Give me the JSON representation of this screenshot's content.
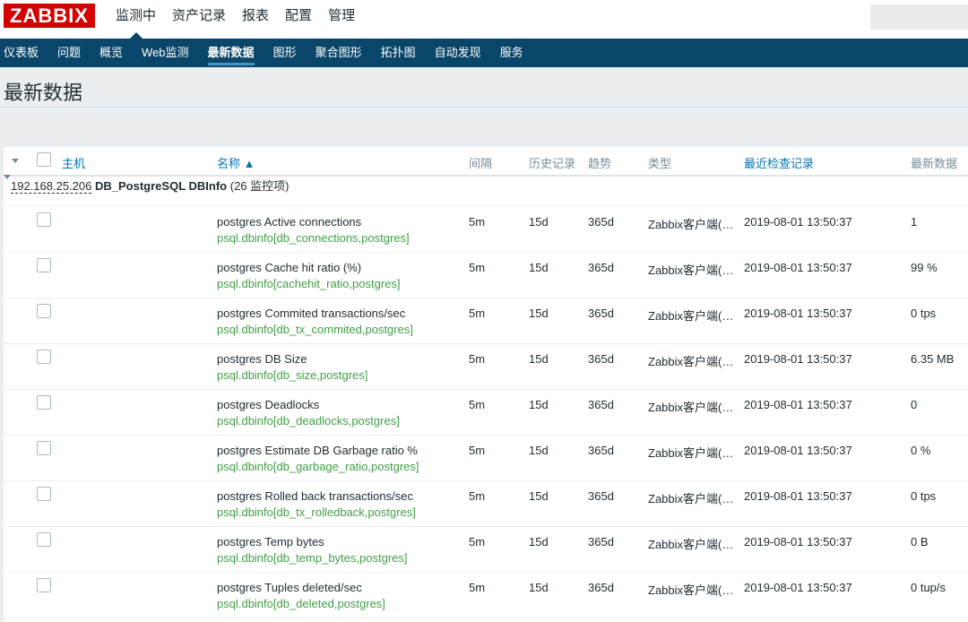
{
  "logo": "ZABBIX",
  "main_menu": [
    "监测中",
    "资产记录",
    "报表",
    "配置",
    "管理"
  ],
  "sub_menu": [
    "仪表板",
    "问题",
    "概览",
    "Web监测",
    "最新数据",
    "图形",
    "聚合图形",
    "拓扑图",
    "自动发现",
    "服务"
  ],
  "page_title": "最新数据",
  "table": {
    "headers": {
      "host": "主机",
      "name": "名称 ▲",
      "interval": "间隔",
      "history": "历史记录",
      "trends": "趋势",
      "type": "类型",
      "last_check": "最近检查记录",
      "last_value": "最新数据"
    },
    "group": {
      "host": "192.168.25.206",
      "app": "DB_PostgreSQL DBInfo",
      "count": "(26 监控项)"
    },
    "rows": [
      {
        "name": "postgres Active connections",
        "key": "psql.dbinfo[db_connections,postgres]",
        "interval": "5m",
        "history": "15d",
        "trends": "365d",
        "type": "Zabbix客户端(…",
        "last_check": "2019-08-01 13:50:37",
        "last_value": "1"
      },
      {
        "name": "postgres Cache hit ratio (%)",
        "key": "psql.dbinfo[cachehit_ratio,postgres]",
        "interval": "5m",
        "history": "15d",
        "trends": "365d",
        "type": "Zabbix客户端(…",
        "last_check": "2019-08-01 13:50:37",
        "last_value": "99 %"
      },
      {
        "name": "postgres Commited transactions/sec",
        "key": "psql.dbinfo[db_tx_commited,postgres]",
        "interval": "5m",
        "history": "15d",
        "trends": "365d",
        "type": "Zabbix客户端(…",
        "last_check": "2019-08-01 13:50:37",
        "last_value": "0 tps"
      },
      {
        "name": "postgres DB Size",
        "key": "psql.dbinfo[db_size,postgres]",
        "interval": "5m",
        "history": "15d",
        "trends": "365d",
        "type": "Zabbix客户端(…",
        "last_check": "2019-08-01 13:50:37",
        "last_value": "6.35 MB"
      },
      {
        "name": "postgres Deadlocks",
        "key": "psql.dbinfo[db_deadlocks,postgres]",
        "interval": "5m",
        "history": "15d",
        "trends": "365d",
        "type": "Zabbix客户端(…",
        "last_check": "2019-08-01 13:50:37",
        "last_value": "0"
      },
      {
        "name": "postgres Estimate DB Garbage ratio %",
        "key": "psql.dbinfo[db_garbage_ratio,postgres]",
        "interval": "5m",
        "history": "15d",
        "trends": "365d",
        "type": "Zabbix客户端(…",
        "last_check": "2019-08-01 13:50:37",
        "last_value": "0 %"
      },
      {
        "name": "postgres Rolled back transactions/sec",
        "key": "psql.dbinfo[db_tx_rolledback,postgres]",
        "interval": "5m",
        "history": "15d",
        "trends": "365d",
        "type": "Zabbix客户端(…",
        "last_check": "2019-08-01 13:50:37",
        "last_value": "0 tps"
      },
      {
        "name": "postgres Temp bytes",
        "key": "psql.dbinfo[db_temp_bytes,postgres]",
        "interval": "5m",
        "history": "15d",
        "trends": "365d",
        "type": "Zabbix客户端(…",
        "last_check": "2019-08-01 13:50:37",
        "last_value": "0 B"
      },
      {
        "name": "postgres Tuples deleted/sec",
        "key": "psql.dbinfo[db_deleted,postgres]",
        "interval": "5m",
        "history": "15d",
        "trends": "365d",
        "type": "Zabbix客户端(…",
        "last_check": "2019-08-01 13:50:37",
        "last_value": "0 tup/s"
      }
    ]
  },
  "colors": {
    "brand": "#d40000",
    "nav": "#0a466a",
    "link": "#0275b8",
    "key_text": "#429e47"
  }
}
